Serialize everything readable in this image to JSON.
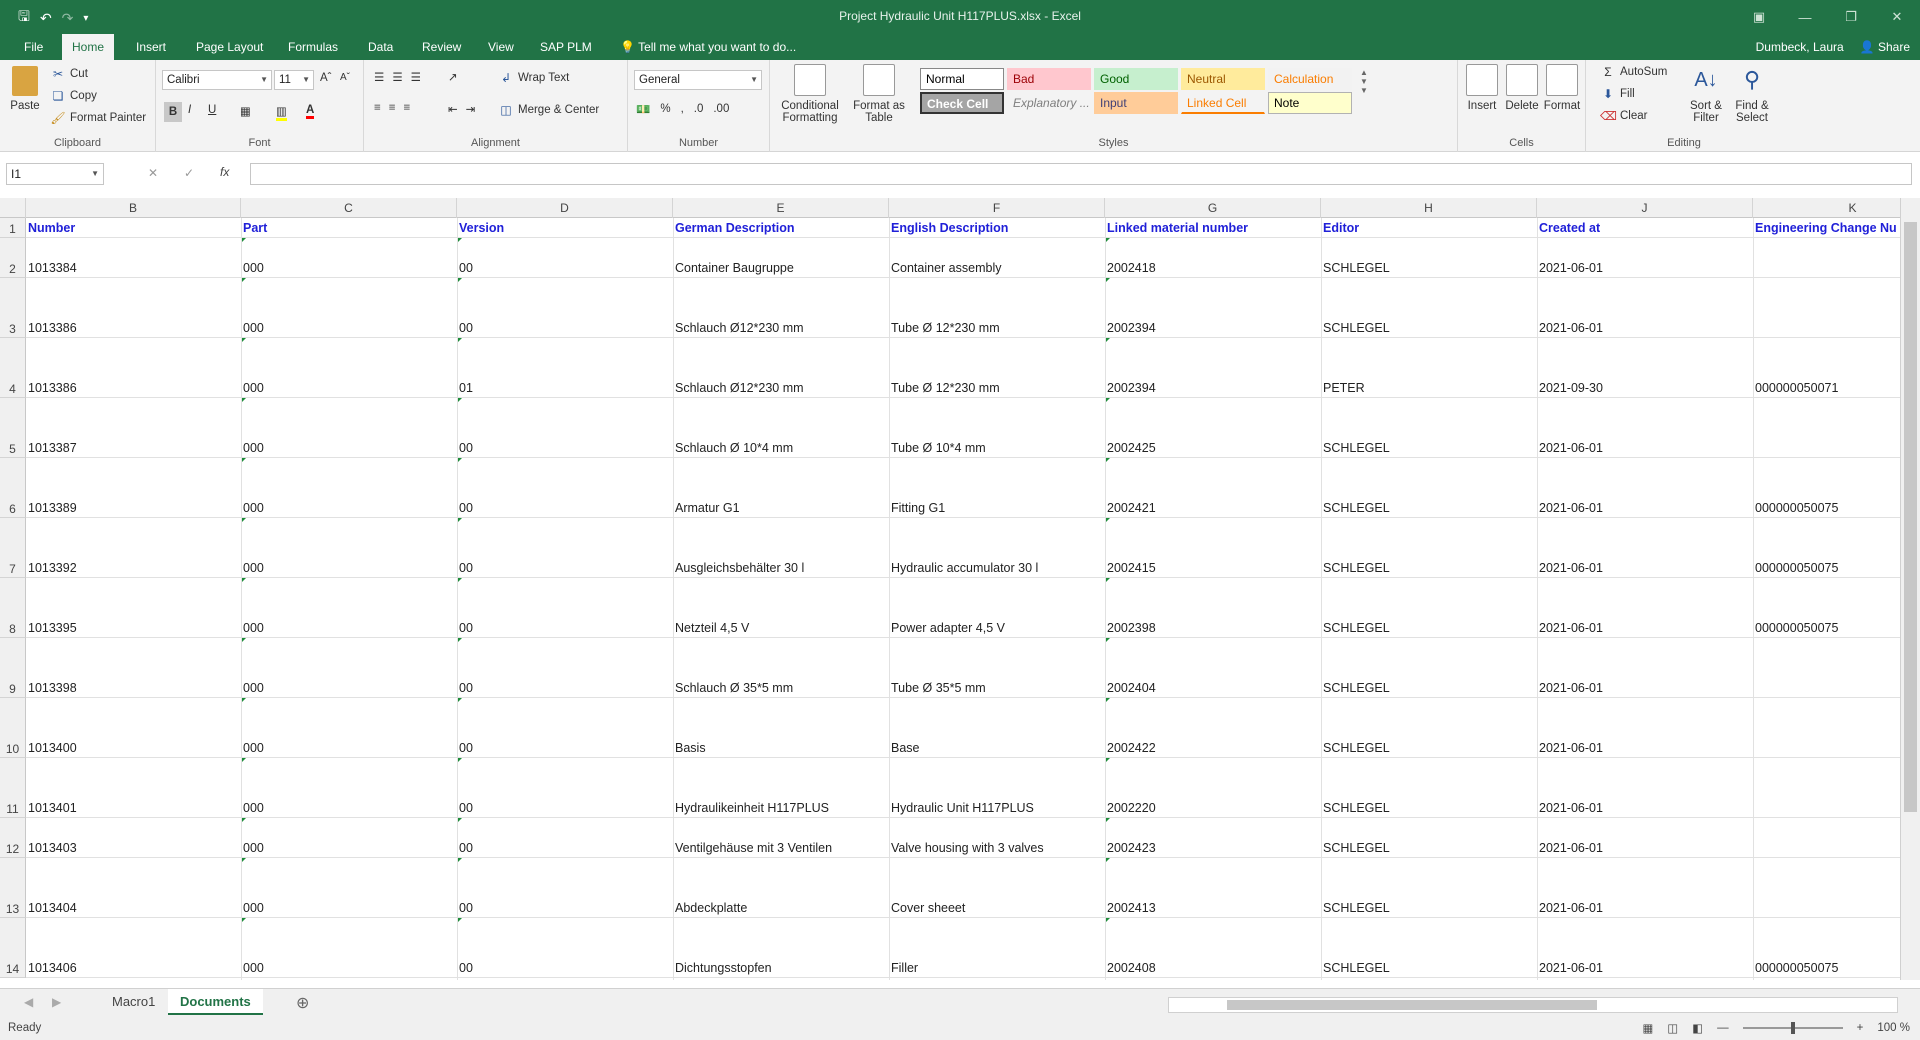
{
  "window": {
    "title": "Project Hydraulic Unit H117PLUS.xlsx - Excel",
    "user": "Dumbeck, Laura",
    "share": "Share"
  },
  "tabs": [
    "File",
    "Home",
    "Insert",
    "Page Layout",
    "Formulas",
    "Data",
    "Review",
    "View",
    "SAP PLM"
  ],
  "tell_me": "Tell me what you want to do...",
  "ribbon": {
    "clipboard": {
      "paste": "Paste",
      "cut": "Cut",
      "copy": "Copy",
      "format_painter": "Format Painter",
      "label": "Clipboard"
    },
    "font": {
      "name": "Calibri",
      "size": "11",
      "label": "Font"
    },
    "alignment": {
      "wrap": "Wrap Text",
      "merge": "Merge & Center",
      "label": "Alignment"
    },
    "number": {
      "format": "General",
      "label": "Number"
    },
    "styles": {
      "conditional": "Conditional Formatting",
      "format_table": "Format as Table",
      "label": "Styles",
      "cells": [
        {
          "name": "Normal",
          "bg": "#ffffff",
          "fg": "#000000"
        },
        {
          "name": "Bad",
          "bg": "#ffc7ce",
          "fg": "#9c0006"
        },
        {
          "name": "Good",
          "bg": "#c6efce",
          "fg": "#006100"
        },
        {
          "name": "Neutral",
          "bg": "#ffeb9c",
          "fg": "#9c5700"
        },
        {
          "name": "Calculation",
          "bg": "#f2f2f2",
          "fg": "#fa7d00"
        },
        {
          "name": "Check Cell",
          "bg": "#a5a5a5",
          "fg": "#ffffff"
        },
        {
          "name": "Explanatory ...",
          "bg": "#f3f3f3",
          "fg": "#7f7f7f"
        },
        {
          "name": "Input",
          "bg": "#ffcc99",
          "fg": "#3f3f76"
        },
        {
          "name": "Linked Cell",
          "bg": "#f3f3f3",
          "fg": "#fa7d00"
        },
        {
          "name": "Note",
          "bg": "#ffffcc",
          "fg": "#000000"
        }
      ]
    },
    "cells": {
      "insert": "Insert",
      "delete": "Delete",
      "format": "Format",
      "label": "Cells"
    },
    "editing": {
      "autosum": "AutoSum",
      "fill": "Fill",
      "clear": "Clear",
      "sort": "Sort & Filter",
      "find": "Find & Select",
      "label": "Editing"
    }
  },
  "formula_bar": {
    "name_box": "I1",
    "fx": "fx"
  },
  "columns": [
    "B",
    "C",
    "D",
    "E",
    "F",
    "G",
    "H",
    "J",
    "K"
  ],
  "header_row": [
    "Number",
    "Part",
    "Version",
    "German Description",
    "English Description",
    "Linked material number",
    "Editor",
    "Created at",
    "Engineering Change Nu"
  ],
  "rows": [
    {
      "n": "2",
      "cells": [
        "1013384",
        "000",
        "00",
        "Container Baugruppe",
        "Container assembly",
        "2002418",
        "SCHLEGEL",
        "2021-06-01",
        ""
      ]
    },
    {
      "n": "3",
      "cells": [
        "1013386",
        "000",
        "00",
        "Schlauch Ø12*230 mm",
        "Tube Ø 12*230 mm",
        "2002394",
        "SCHLEGEL",
        "2021-06-01",
        ""
      ]
    },
    {
      "n": "4",
      "cells": [
        "1013386",
        "000",
        "01",
        "Schlauch Ø12*230 mm",
        "Tube Ø 12*230 mm",
        "2002394",
        "PETER",
        "2021-09-30",
        "000000050071"
      ]
    },
    {
      "n": "5",
      "cells": [
        "1013387",
        "000",
        "00",
        "Schlauch Ø 10*4 mm",
        "Tube Ø 10*4 mm",
        "2002425",
        "SCHLEGEL",
        "2021-06-01",
        ""
      ]
    },
    {
      "n": "6",
      "cells": [
        "1013389",
        "000",
        "00",
        "Armatur G1",
        "Fitting G1",
        "2002421",
        "SCHLEGEL",
        "2021-06-01",
        "000000050075"
      ]
    },
    {
      "n": "7",
      "cells": [
        "1013392",
        "000",
        "00",
        "Ausgleichsbehälter 30 l",
        "Hydraulic accumulator 30 l",
        "2002415",
        "SCHLEGEL",
        "2021-06-01",
        "000000050075"
      ]
    },
    {
      "n": "8",
      "cells": [
        "1013395",
        "000",
        "00",
        "Netzteil 4,5 V",
        "Power adapter 4,5 V",
        "2002398",
        "SCHLEGEL",
        "2021-06-01",
        "000000050075"
      ]
    },
    {
      "n": "9",
      "cells": [
        "1013398",
        "000",
        "00",
        "Schlauch Ø 35*5 mm",
        "Tube Ø 35*5 mm",
        "2002404",
        "SCHLEGEL",
        "2021-06-01",
        ""
      ]
    },
    {
      "n": "10",
      "cells": [
        "1013400",
        "000",
        "00",
        "Basis",
        "Base",
        "2002422",
        "SCHLEGEL",
        "2021-06-01",
        ""
      ]
    },
    {
      "n": "11",
      "cells": [
        "1013401",
        "000",
        "00",
        "Hydraulikeinheit H117PLUS",
        "Hydraulic Unit H117PLUS",
        "2002220",
        "SCHLEGEL",
        "2021-06-01",
        ""
      ]
    },
    {
      "n": "12",
      "cells": [
        "1013403",
        "000",
        "00",
        "Ventilgehäuse mit 3 Ventilen",
        "Valve housing with 3 valves",
        "2002423",
        "SCHLEGEL",
        "2021-06-01",
        ""
      ]
    },
    {
      "n": "13",
      "cells": [
        "1013404",
        "000",
        "00",
        "Abdeckplatte",
        "Cover sheeet",
        "2002413",
        "SCHLEGEL",
        "2021-06-01",
        ""
      ]
    },
    {
      "n": "14",
      "cells": [
        "1013406",
        "000",
        "00",
        "Dichtungsstopfen",
        "Filler",
        "2002408",
        "SCHLEGEL",
        "2021-06-01",
        "000000050075"
      ]
    }
  ],
  "sheets": [
    "Macro1",
    "Documents"
  ],
  "status": {
    "ready": "Ready",
    "zoom": "100 %"
  }
}
